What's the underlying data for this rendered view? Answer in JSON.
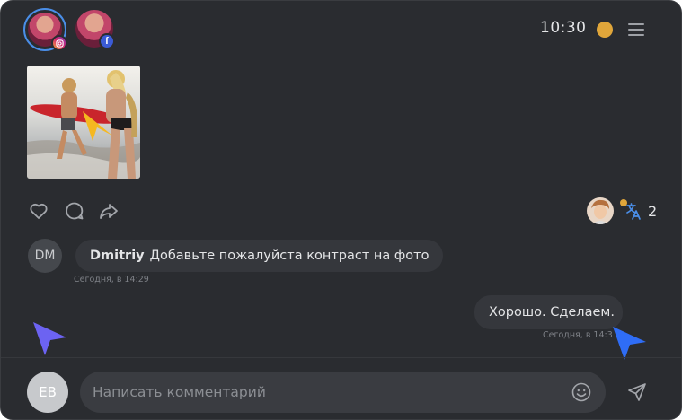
{
  "header": {
    "time": "10:30",
    "status_color": "#e0a63a",
    "accounts": [
      {
        "network": "instagram",
        "icon": "instagram-icon",
        "active": true
      },
      {
        "network": "facebook",
        "icon": "facebook-icon",
        "active": false
      }
    ]
  },
  "post": {
    "actions": [
      "heart-icon",
      "comment-icon",
      "share-icon"
    ],
    "viewer_count": "2"
  },
  "comments": [
    {
      "initials": "DM",
      "author": "Dmitriy",
      "text": "Добавьте пожалуйста контраст на фото",
      "time": "Сегодня, в 14:29"
    }
  ],
  "reply": {
    "text": "Хорошо. Сделаем.",
    "time": "Сегодня, в 14:3"
  },
  "composer": {
    "initials": "EB",
    "placeholder": "Написать комментарий"
  },
  "colors": {
    "background": "#2a2c30",
    "bubble": "#35373c",
    "accent_blue": "#2f6df6",
    "accent_purple": "#6c63f2",
    "accent_yellow": "#f5b820"
  }
}
